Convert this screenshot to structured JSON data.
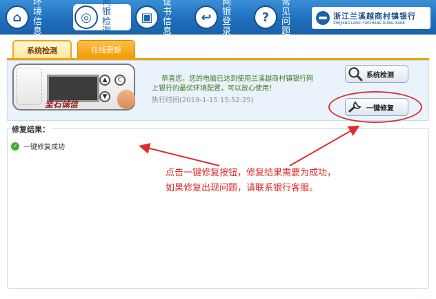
{
  "nav": {
    "items": [
      {
        "icon": "home-icon",
        "glyph": "⌂",
        "label": "环境信息"
      },
      {
        "icon": "bank-check-icon",
        "glyph": "◎",
        "label": "网银检测",
        "active": true
      },
      {
        "icon": "certificate-icon",
        "glyph": "▣",
        "label": "证书信息"
      },
      {
        "icon": "login-icon",
        "glyph": "↩",
        "label": "网银登录"
      },
      {
        "icon": "help-icon",
        "glyph": "?",
        "label": "常见问题"
      }
    ]
  },
  "bank": {
    "name_cn": "浙江兰溪越商村镇银行",
    "name_en": "ZHEJIANG LANXI YUESHANG RURAL BANK"
  },
  "tabs": {
    "active_label": "系统检测",
    "inactive_label": "在线更新"
  },
  "device": {
    "brand": "坚石诚信",
    "btn_a": "▲",
    "btn_c": "C",
    "btn_down": "▼"
  },
  "message": {
    "line1": "恭喜您，您的电脑已达到使用兰溪越商村镇银行网",
    "line2": "上银行的最优环境配置，可以放心使用！",
    "exec_label": "执行时间",
    "exec_time": "(2019-1-15 15:52:25)"
  },
  "buttons": {
    "check_label": "系统检测",
    "repair_label": "一键修复"
  },
  "results": {
    "title": "修复结果：",
    "item": "一键修复成功"
  },
  "annotation": {
    "line1": "点击一键修复按钮，修复结果需要为成功，",
    "line2": "如果修复出现问题，请联系银行客服。"
  },
  "colors": {
    "nav_bg": "#1f6fbd",
    "tab_orange": "#f39b00",
    "annotation_red": "#e02b2b",
    "success_green": "#3fae2a"
  }
}
